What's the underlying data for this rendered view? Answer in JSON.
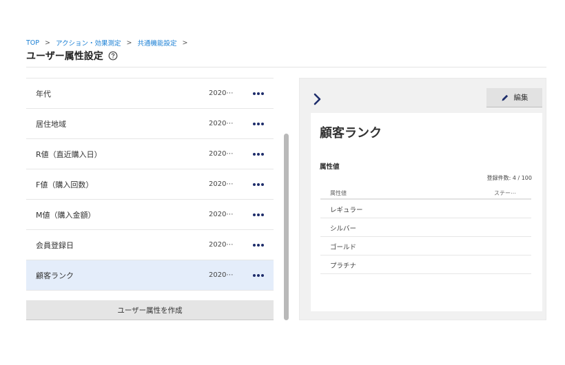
{
  "breadcrumb": {
    "items": [
      "TOP",
      "アクション・効果測定",
      "共通機能設定"
    ],
    "separator": ">"
  },
  "page": {
    "title": "ユーザー属性設定"
  },
  "list": {
    "rows": [
      {
        "name": "年代",
        "date": "2020⋯"
      },
      {
        "name": "居住地域",
        "date": "2020⋯"
      },
      {
        "name": "R値（直近購入日）",
        "date": "2020⋯"
      },
      {
        "name": "F値（購入回数）",
        "date": "2020⋯"
      },
      {
        "name": "M値（購入金額）",
        "date": "2020⋯"
      },
      {
        "name": "会員登録日",
        "date": "2020⋯"
      },
      {
        "name": "顧客ランク",
        "date": "2020⋯"
      }
    ],
    "selected_index": 6,
    "create_button_label": "ユーザー属性を作成"
  },
  "detail": {
    "edit_label": "編集",
    "title": "顧客ランク",
    "section_label": "属性値",
    "count_label": "登録件数: ",
    "count_value": "4",
    "count_max": " / 100",
    "table": {
      "headers": [
        "属性値",
        "ステー⋯"
      ],
      "rows": [
        "レギュラー",
        "シルバー",
        "ゴールド",
        "プラチナ"
      ]
    }
  },
  "colors": {
    "link": "#1a7fd4",
    "selected_row": "#e4edfa",
    "icon_navy": "#1e2d6b"
  },
  "icons": {
    "help": "question-circle-icon",
    "more": "ellipsis-horizontal-icon",
    "collapse": "chevron-right-icon",
    "edit": "pencil-icon"
  }
}
